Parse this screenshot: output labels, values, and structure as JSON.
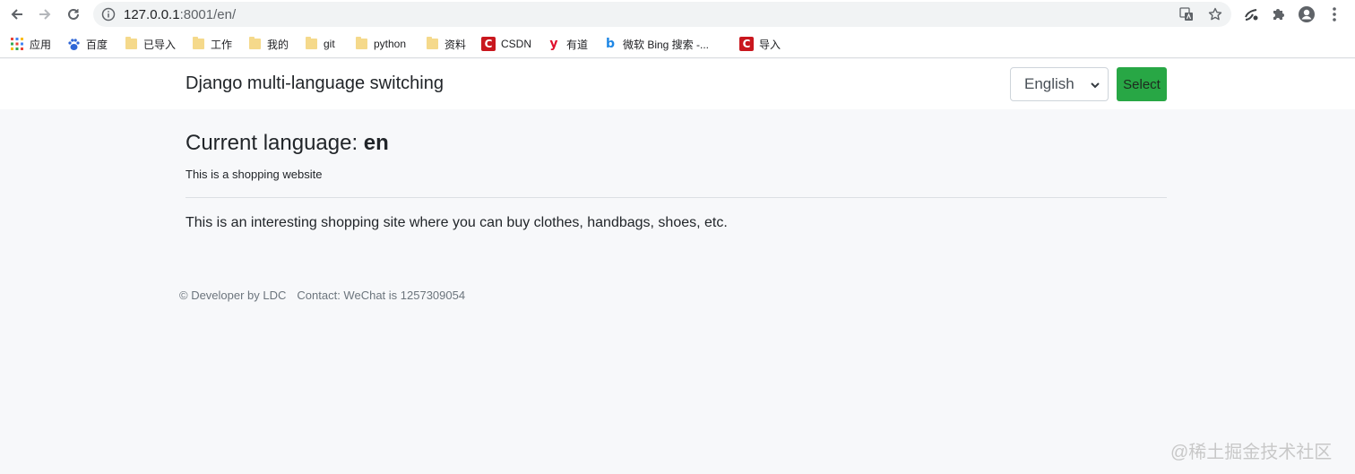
{
  "browser": {
    "url_host": "127.0.0.1",
    "url_rest": ":8001/en/",
    "bookmarks": [
      {
        "label": "应用",
        "icon": "apps-grid-icon"
      },
      {
        "label": "百度",
        "icon": "baidu-paw-icon"
      },
      {
        "label": "已导入",
        "icon": "folder-icon"
      },
      {
        "label": "工作",
        "icon": "folder-icon"
      },
      {
        "label": "我的",
        "icon": "folder-icon"
      },
      {
        "label": "git",
        "icon": "folder-icon"
      },
      {
        "label": "python",
        "icon": "folder-icon"
      },
      {
        "label": "资料",
        "icon": "folder-icon"
      },
      {
        "label": "CSDN",
        "icon": "csdn-logo-icon"
      },
      {
        "label": "有道",
        "icon": "youdao-logo-icon"
      },
      {
        "label": "微软 Bing 搜索 -...",
        "icon": "bing-logo-icon"
      },
      {
        "label": "导入",
        "icon": "csdn-logo-icon"
      }
    ],
    "icon_glyphs": {
      "csdn": "C",
      "youdao": "y",
      "bing": "b"
    }
  },
  "page": {
    "brand": "Django multi-language switching",
    "language_select": {
      "selected": "English"
    },
    "select_button": "Select",
    "heading_prefix": "Current language: ",
    "heading_lang": "en",
    "subtitle": "This is a shopping website",
    "body": "This is an interesting shopping site where you can buy clothes, handbags, shoes, etc.",
    "footer": {
      "developer": "© Developer by LDC",
      "contact": "Contact: WeChat is 1257309054"
    },
    "watermark": "@稀土掘金技术社区"
  },
  "colors": {
    "accent_green": "#28a745",
    "page_background": "#f7f8fa",
    "toolbar_background": "#ffffff"
  }
}
